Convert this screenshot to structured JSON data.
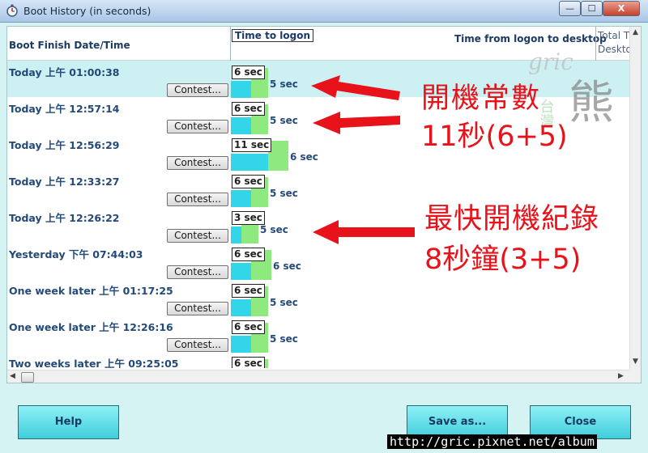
{
  "window": {
    "title": "Boot History (in seconds)",
    "minimize_glyph": "—",
    "maximize_glyph": "☐",
    "close_glyph": "X"
  },
  "columns": {
    "date": "Boot Finish Date/Time",
    "logon": "Time to logon",
    "desktop": "Time from logon to desktop",
    "total_line1": "Total T",
    "total_line2": "Desktop"
  },
  "rows": [
    {
      "date": "Today  上午 01:00:38",
      "logon_label": "6 sec",
      "logon_sec": 6,
      "desktop_label": "5 sec",
      "desktop_sec": 5,
      "contest": "Contest...",
      "selected": true
    },
    {
      "date": "Today  上午 12:57:14",
      "logon_label": "6 sec",
      "logon_sec": 6,
      "desktop_label": "5 sec",
      "desktop_sec": 5,
      "contest": "Contest..."
    },
    {
      "date": "Today  上午 12:56:29",
      "logon_label": "11 sec",
      "logon_sec": 11,
      "desktop_label": "6 sec",
      "desktop_sec": 6,
      "contest": "Contest..."
    },
    {
      "date": "Today  上午 12:33:27",
      "logon_label": "6 sec",
      "logon_sec": 6,
      "desktop_label": "5 sec",
      "desktop_sec": 5,
      "contest": "Contest..."
    },
    {
      "date": "Today  上午 12:26:22",
      "logon_label": "3 sec",
      "logon_sec": 3,
      "desktop_label": "5 sec",
      "desktop_sec": 5,
      "contest": "Contest..."
    },
    {
      "date": "Yesterday  下午 07:44:03",
      "logon_label": "6 sec",
      "logon_sec": 6,
      "desktop_label": "6 sec",
      "desktop_sec": 6,
      "contest": "Contest..."
    },
    {
      "date": "One week later  上午 01:17:25",
      "logon_label": "6 sec",
      "logon_sec": 6,
      "desktop_label": "5 sec",
      "desktop_sec": 5,
      "contest": "Contest..."
    },
    {
      "date": "One week later  上午 12:26:16",
      "logon_label": "6 sec",
      "logon_sec": 6,
      "desktop_label": "5 sec",
      "desktop_sec": 5,
      "contest": "Contest..."
    },
    {
      "date": "Two weeks later  上午 09:25:05",
      "logon_label": "6 sec",
      "logon_sec": 6,
      "desktop_label": "",
      "desktop_sec": 5,
      "contest": ""
    }
  ],
  "buttons": {
    "help": "Help",
    "save": "Save as...",
    "close": "Close"
  },
  "annotations": {
    "line1": "開機常數",
    "line2": "11秒(6+5)",
    "line3": "最快開機紀錄",
    "line4": "8秒鐘(3+5)"
  },
  "logo": {
    "script": "gric",
    "chars": "台灣",
    "bear": "熊"
  },
  "footer_url": "http://gric.pixnet.net/album",
  "colors": {
    "logon_bar": "#33d6e9",
    "desktop_bar": "#8eea7f",
    "annotation": "#e8121a",
    "selected_row": "#cdf1f3"
  }
}
